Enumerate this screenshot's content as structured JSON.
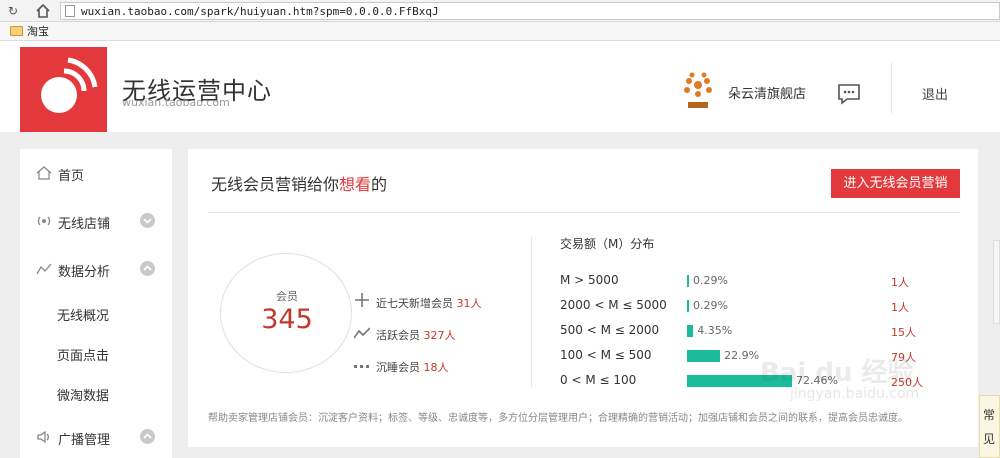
{
  "browser": {
    "url": "wuxian.taobao.com/spark/huiyuan.htm?spm=0.0.0.0.FfBxqJ",
    "bookmark": "淘宝"
  },
  "header": {
    "title": "无线运营中心",
    "subtitle": "wuxian.taobao.com",
    "shop_name": "朵云清旗舰店",
    "logout": "退出"
  },
  "sidebar": {
    "home": "首页",
    "store": "无线店铺",
    "analysis": "数据分析",
    "analysis_items": [
      "无线概况",
      "页面点击",
      "微淘数据"
    ],
    "broadcast": "广播管理"
  },
  "main": {
    "title_prefix": "无线会员营销给你",
    "title_highlight": "想看",
    "title_suffix": "的",
    "enter_button": "进入无线会员营销",
    "member_label": "会员",
    "member_count": "345",
    "stats": [
      {
        "label": "近七天新增会员",
        "value": "31人"
      },
      {
        "label": "活跃会员",
        "value": "327人"
      },
      {
        "label": "沉睡会员",
        "value": "18人"
      }
    ],
    "dist_title": "交易额（M）分布",
    "distribution": [
      {
        "range": "M > 5000",
        "percent": "0.29%",
        "count": "1人",
        "value": 0.29
      },
      {
        "range": "2000 < M ≤ 5000",
        "percent": "0.29%",
        "count": "1人",
        "value": 0.29
      },
      {
        "range": "500 < M ≤ 2000",
        "percent": "4.35%",
        "count": "15人",
        "value": 4.35
      },
      {
        "range": "100 < M ≤ 500",
        "percent": "22.9%",
        "count": "79人",
        "value": 22.9
      },
      {
        "range": "0 < M ≤ 100",
        "percent": "72.46%",
        "count": "250人",
        "value": 72.46
      }
    ],
    "footer_note": "帮助卖家管理店铺会员：沉淀客户资料；标签、等级、忠诚度等，多方位分层管理用户；合理精确的营销活动；加强店铺和会员之间的联系，提高会员忠诚度。"
  },
  "edge_tab": [
    "常",
    "见"
  ],
  "watermark": {
    "main": "Bai du 经验",
    "sub": "jingyan.baidu.com"
  },
  "colors": {
    "accent": "#e4393c",
    "bar": "#1abc9c",
    "number": "#c0392b"
  }
}
